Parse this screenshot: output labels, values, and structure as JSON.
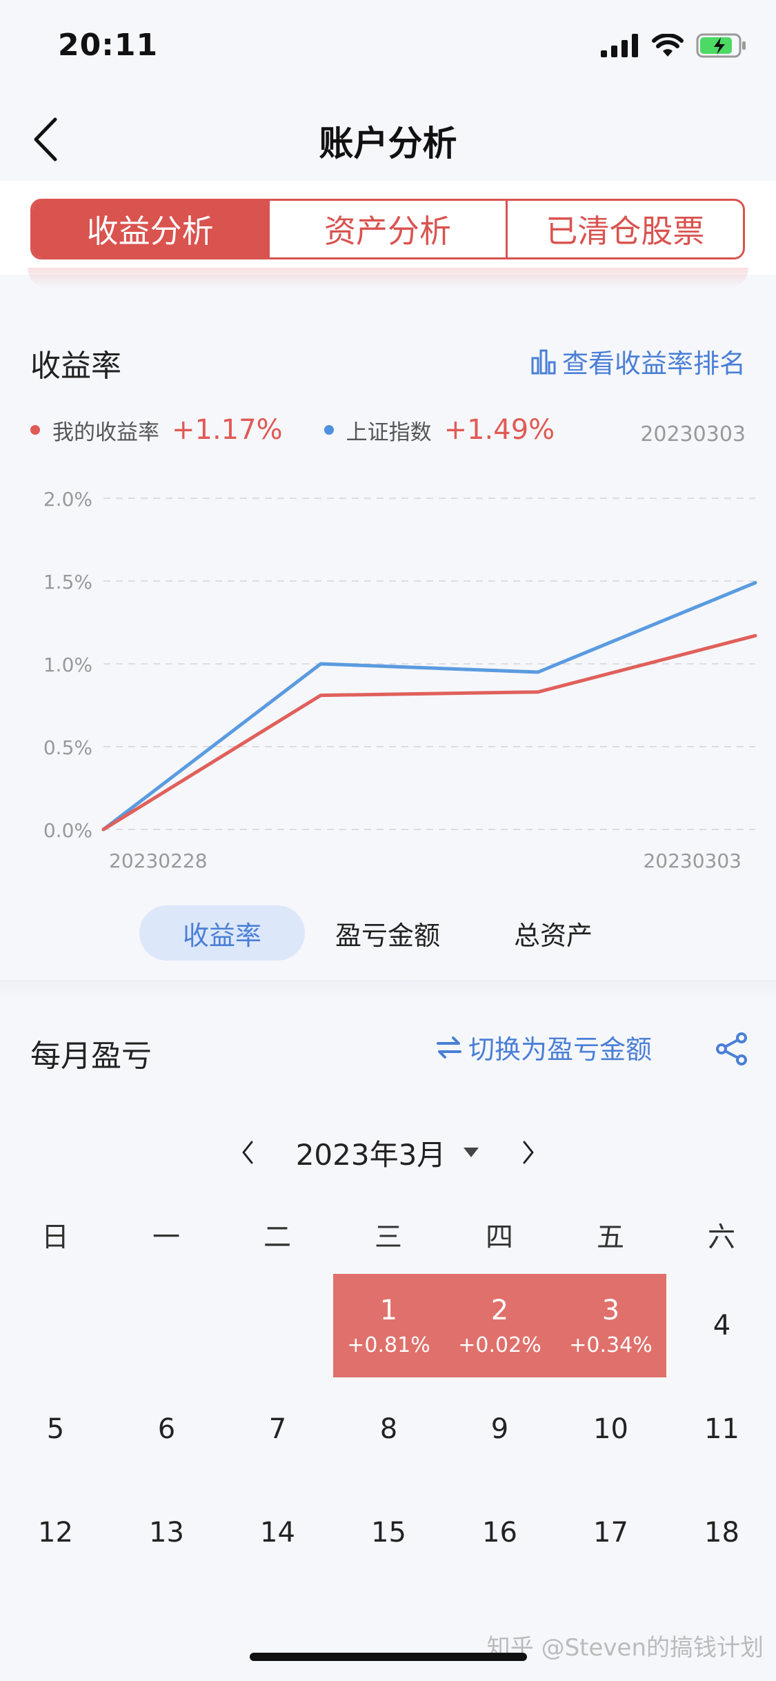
{
  "status": {
    "time": "20:11"
  },
  "nav": {
    "title": "账户分析"
  },
  "tabs": [
    {
      "label": "收益分析",
      "active": true
    },
    {
      "label": "资产分析",
      "active": false
    },
    {
      "label": "已清仓股票",
      "active": false
    }
  ],
  "returns": {
    "title": "收益率",
    "ranking_link": "查看收益率排名",
    "legend": [
      {
        "label": "我的收益率",
        "value": "+1.17%",
        "color": "#e05a55"
      },
      {
        "label": "上证指数",
        "value": "+1.49%",
        "color": "#4f90e0"
      }
    ],
    "date": "20230303"
  },
  "chart_data": {
    "type": "line",
    "x": [
      "20230228",
      "20230301",
      "20230302",
      "20230303"
    ],
    "x_tick_labels": [
      "20230228",
      "20230303"
    ],
    "y_tick_labels": [
      "0.0%",
      "0.5%",
      "1.0%",
      "1.5%",
      "2.0%"
    ],
    "ylim": [
      0,
      2.0
    ],
    "grid": true,
    "series": [
      {
        "name": "我的收益率",
        "color": "#e0605b",
        "values": [
          0,
          0.81,
          0.83,
          1.17
        ]
      },
      {
        "name": "上证指数",
        "color": "#5a9be0",
        "values": [
          0,
          1.0,
          0.95,
          1.49
        ]
      }
    ]
  },
  "chips": [
    {
      "label": "收益率",
      "active": true
    },
    {
      "label": "盈亏金额",
      "active": false
    },
    {
      "label": "总资产",
      "active": false
    }
  ],
  "monthly": {
    "title": "每月盈亏",
    "switch_link": "切换为盈亏金额",
    "month_label": "2023年3月"
  },
  "calendar": {
    "weekdays": [
      "日",
      "一",
      "二",
      "三",
      "四",
      "五",
      "六"
    ],
    "rows": [
      [
        null,
        null,
        null,
        {
          "day": "1",
          "pct": "+0.81%"
        },
        {
          "day": "2",
          "pct": "+0.02%"
        },
        {
          "day": "3",
          "pct": "+0.34%"
        },
        {
          "day": "4"
        }
      ],
      [
        {
          "day": "5"
        },
        {
          "day": "6"
        },
        {
          "day": "7"
        },
        {
          "day": "8"
        },
        {
          "day": "9"
        },
        {
          "day": "10"
        },
        {
          "day": "11"
        }
      ],
      [
        {
          "day": "12"
        },
        {
          "day": "13"
        },
        {
          "day": "14"
        },
        {
          "day": "15"
        },
        {
          "day": "16"
        },
        {
          "day": "17"
        },
        {
          "day": "18"
        }
      ]
    ]
  },
  "watermark": "知乎 @Steven的搞钱计划"
}
